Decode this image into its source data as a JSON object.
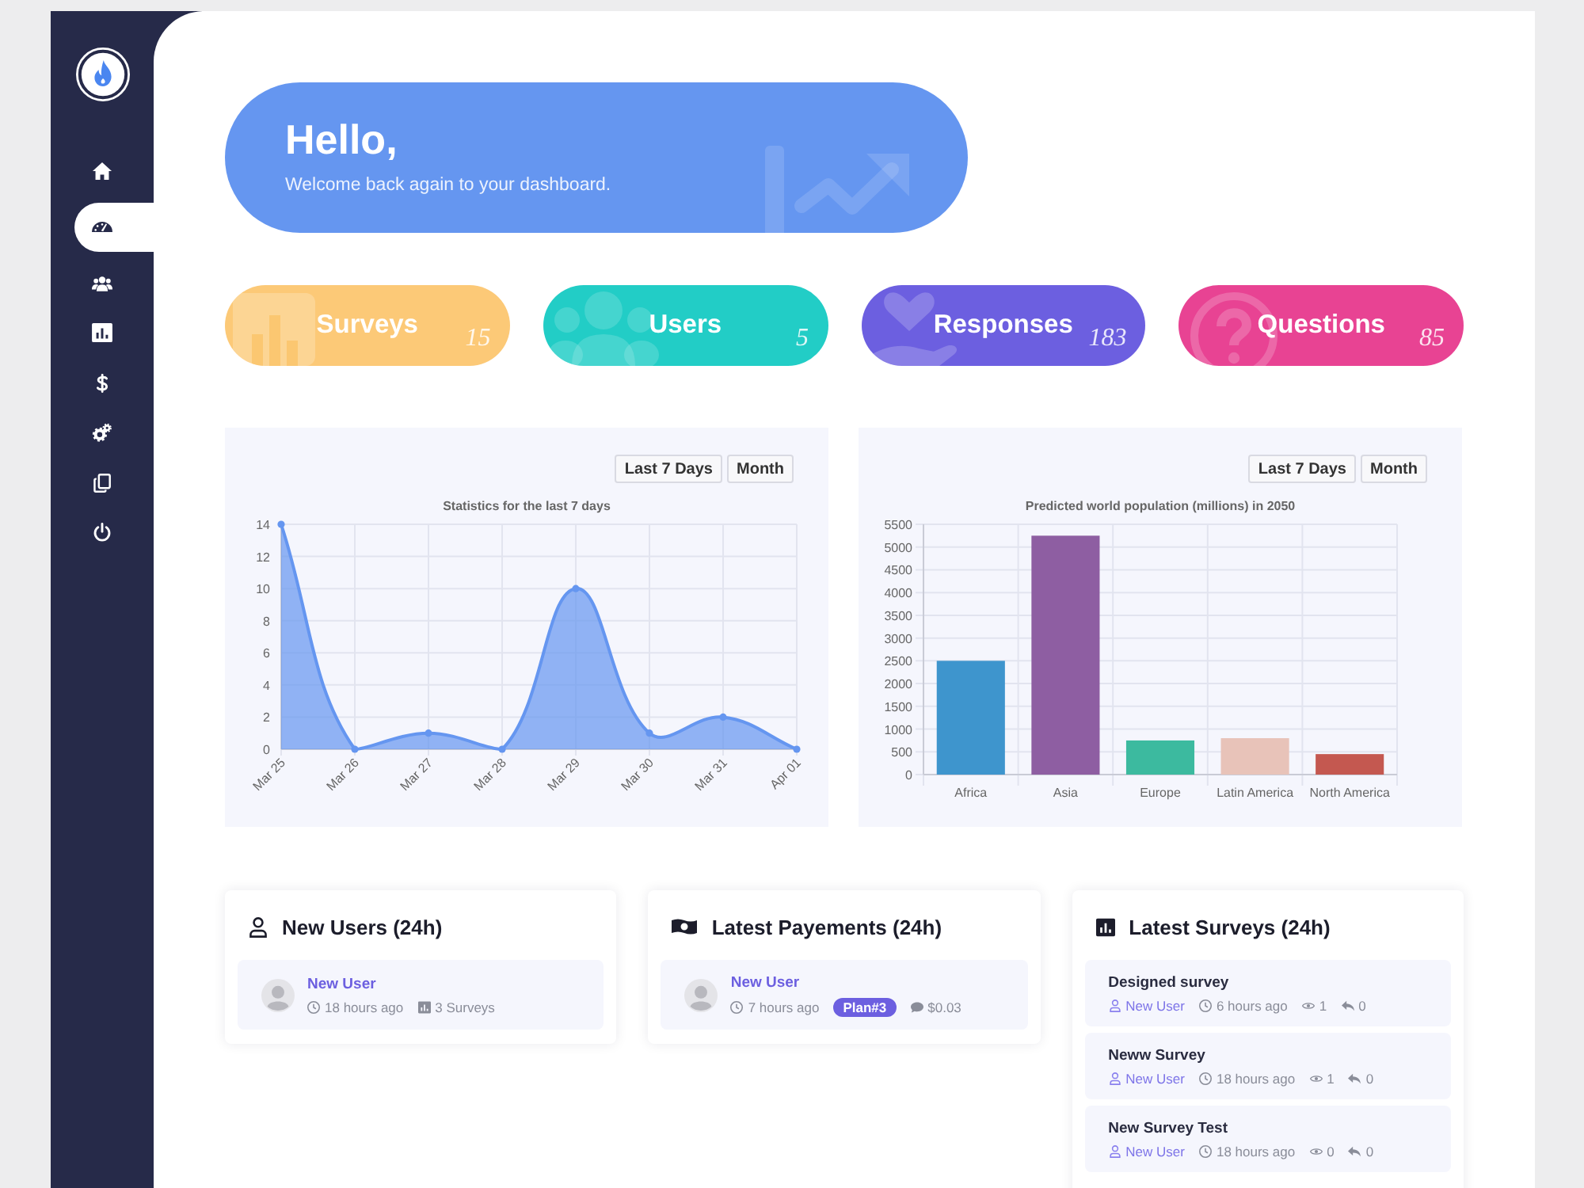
{
  "sidebar": {
    "nav": [
      {
        "selected": false
      },
      {
        "selected": true
      },
      {
        "selected": false
      },
      {
        "selected": false
      },
      {
        "selected": false
      },
      {
        "selected": false
      },
      {
        "selected": false
      },
      {
        "selected": false
      }
    ]
  },
  "greeting": {
    "title": "Hello,",
    "subtitle": "Welcome back again to your dashboard."
  },
  "stats": [
    {
      "label": "Surveys",
      "count": "15",
      "color": "#fcc977"
    },
    {
      "label": "Users",
      "count": "5",
      "color": "#22cdc6"
    },
    {
      "label": "Responses",
      "count": "183",
      "color": "#6c5fe0"
    },
    {
      "label": "Questions",
      "count": "85",
      "color": "#e84393"
    }
  ],
  "charts": [
    {
      "buttons": [
        "Last 7 Days",
        "Month"
      ],
      "chart_data": {
        "type": "area",
        "title": "Statistics for the last 7 days",
        "categories": [
          "Mar 25",
          "Mar 26",
          "Mar 27",
          "Mar 28",
          "Mar 29",
          "Mar 30",
          "Mar 31",
          "Apr 01"
        ],
        "values": [
          14,
          0,
          1,
          0,
          10,
          1,
          2,
          0
        ],
        "color": "#6596f0",
        "ylim": [
          0,
          14
        ],
        "yticks": [
          0,
          2,
          4,
          6,
          8,
          10,
          12,
          14
        ],
        "grid": true,
        "marker": "circle"
      }
    },
    {
      "buttons": [
        "Last 7 Days",
        "Month"
      ],
      "chart_data": {
        "type": "bar",
        "title": "Predicted world population (millions) in 2050",
        "categories": [
          "Africa",
          "Asia",
          "Europe",
          "Latin America",
          "North America"
        ],
        "values": [
          2500,
          5250,
          750,
          800,
          450
        ],
        "colors": [
          "#3e95cd",
          "#8e5ea2",
          "#3cba9f",
          "#e8c3b9",
          "#c45850"
        ],
        "ylim": [
          0,
          5500
        ],
        "yticks": [
          0,
          500,
          1000,
          1500,
          2000,
          2500,
          3000,
          3500,
          4000,
          4500,
          5000,
          5500
        ],
        "grid": true
      }
    }
  ],
  "new_users": {
    "title": "New Users (24h)",
    "items": [
      {
        "name": "New User",
        "time": "18 hours ago",
        "surveys": "3 Surveys"
      }
    ]
  },
  "latest_payments": {
    "title": "Latest Payements (24h)",
    "items": [
      {
        "name": "New User",
        "time": "7 hours ago",
        "plan": "Plan#3",
        "amount": "$0.03"
      }
    ]
  },
  "latest_surveys": {
    "title": "Latest Surveys (24h)",
    "items": [
      {
        "title": "Designed survey",
        "author": "New User",
        "time": "6 hours ago",
        "views": "1",
        "replies": "0"
      },
      {
        "title": "Neww Survey",
        "author": "New User",
        "time": "18 hours ago",
        "views": "1",
        "replies": "0"
      },
      {
        "title": "New Survey Test",
        "author": "New User",
        "time": "18 hours ago",
        "views": "0",
        "replies": "0"
      }
    ]
  }
}
